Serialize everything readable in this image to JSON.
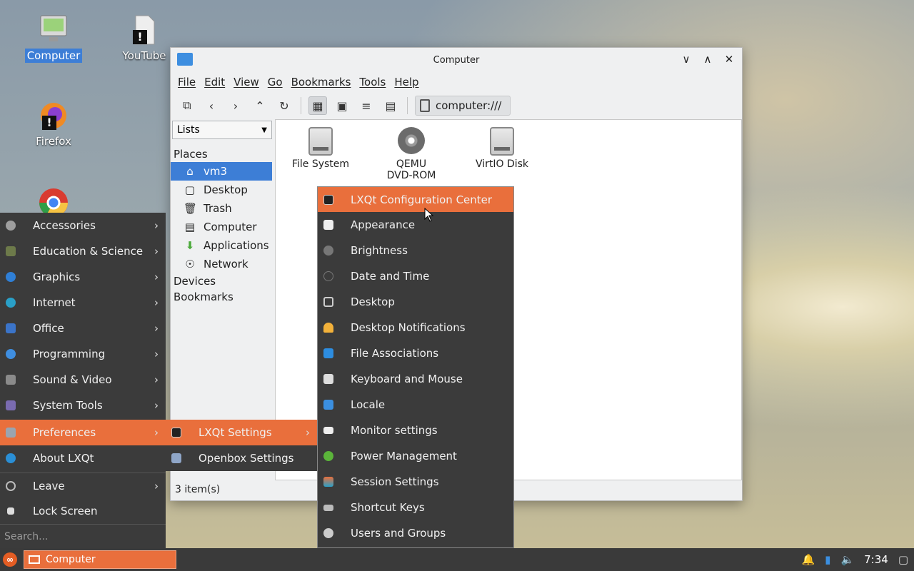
{
  "desktop": {
    "icons": [
      {
        "label": "Computer",
        "icon": "computer-icon"
      },
      {
        "label": "YouTube",
        "icon": "file-warning-icon"
      },
      {
        "label": "Firefox",
        "icon": "firefox-icon"
      },
      {
        "label": "",
        "icon": "chrome-icon"
      }
    ]
  },
  "window": {
    "title": "Computer",
    "menubar": [
      "File",
      "Edit",
      "View",
      "Go",
      "Bookmarks",
      "Tools",
      "Help"
    ],
    "path": "computer:///",
    "side_combo": "Lists",
    "places_header": "Places",
    "places": [
      {
        "label": "vm3",
        "icon": "home-icon"
      },
      {
        "label": "Desktop",
        "icon": "desktop-icon"
      },
      {
        "label": "Trash",
        "icon": "trash-icon"
      },
      {
        "label": "Computer",
        "icon": "computer-icon"
      },
      {
        "label": "Applications",
        "icon": "applications-icon"
      },
      {
        "label": "Network",
        "icon": "network-icon"
      }
    ],
    "devices_header": "Devices",
    "bookmarks_header": "Bookmarks",
    "files": [
      {
        "label": "File System",
        "icon": "harddisk-icon"
      },
      {
        "label": "QEMU DVD-ROM",
        "icon": "optical-disc-icon"
      },
      {
        "label": "VirtIO Disk",
        "icon": "harddisk-icon"
      }
    ],
    "status": "3 item(s)"
  },
  "app_menu": {
    "items": [
      {
        "label": "Accessories",
        "color": "#9e9e9e"
      },
      {
        "label": "Education & Science",
        "color": "#6d7a4a"
      },
      {
        "label": "Graphics",
        "color": "#2f7fd6"
      },
      {
        "label": "Internet",
        "color": "#2aa0c8"
      },
      {
        "label": "Office",
        "color": "#3b74c9"
      },
      {
        "label": "Programming",
        "color": "#3f8ee0"
      },
      {
        "label": "Sound & Video",
        "color": "#8a8a8a"
      },
      {
        "label": "System Tools",
        "color": "#7a6bb0"
      },
      {
        "label": "Preferences",
        "color": "#9aa4b0"
      },
      {
        "label": "About LXQt",
        "color": "#2a8fd6"
      },
      {
        "label": "Leave",
        "color": "#bbbbbb"
      },
      {
        "label": "Lock Screen",
        "color": "#dddddd"
      }
    ],
    "search_placeholder": "Search..."
  },
  "preferences_menu": {
    "items": [
      "LXQt Settings",
      "Openbox Settings"
    ]
  },
  "lxqt_settings_menu": {
    "items": [
      "LXQt Configuration Center",
      "Appearance",
      "Brightness",
      "Date and Time",
      "Desktop",
      "Desktop Notifications",
      "File Associations",
      "Keyboard and Mouse",
      "Locale",
      "Monitor settings",
      "Power Management",
      "Session Settings",
      "Shortcut Keys",
      "Users and Groups"
    ]
  },
  "taskbar": {
    "task_label": "Computer",
    "clock": "7:34"
  },
  "colors": {
    "accent": "#e96f3c",
    "selection": "#3d7ed6",
    "menu_bg": "#3b3b3b"
  }
}
